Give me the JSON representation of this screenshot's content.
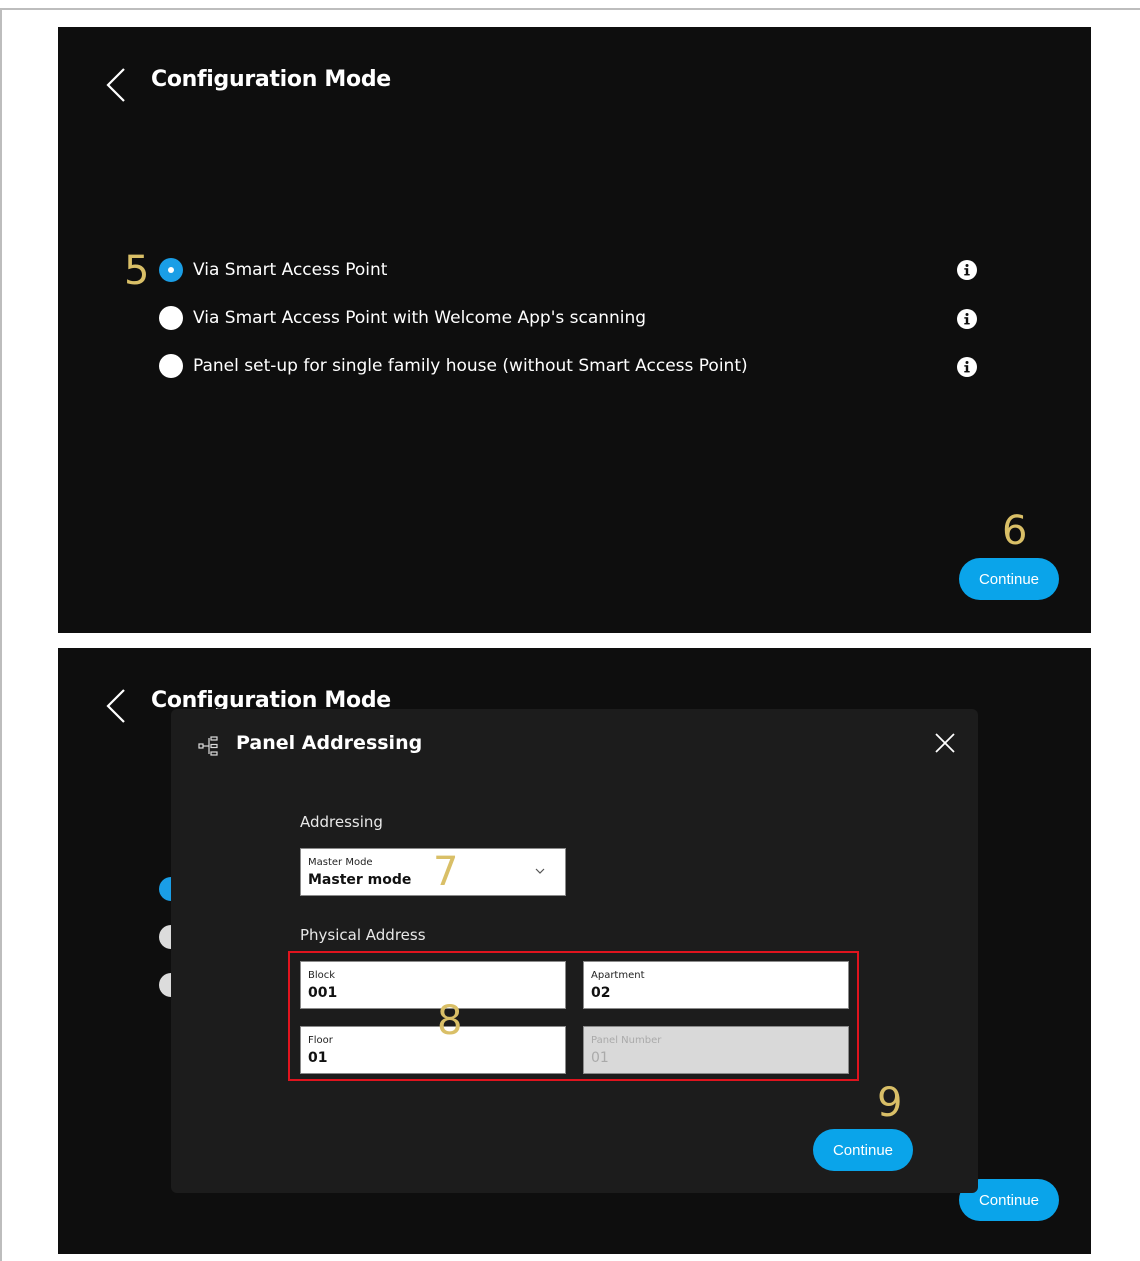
{
  "screen1": {
    "title": "Configuration Mode",
    "options": [
      {
        "label": "Via Smart Access Point",
        "selected": true
      },
      {
        "label": "Via Smart Access Point with Welcome App's scanning",
        "selected": false
      },
      {
        "label": "Panel set-up for single family house (without Smart Access Point)",
        "selected": false
      }
    ],
    "continue_label": "Continue"
  },
  "screen2": {
    "title": "Configuration Mode",
    "continue_label": "Continue",
    "dialog": {
      "title": "Panel Addressing",
      "addressing_label": "Addressing",
      "mode_field": {
        "label": "Master Mode",
        "value": "Master mode"
      },
      "physical_address_label": "Physical Address",
      "block": {
        "label": "Block",
        "value": "001"
      },
      "apartment": {
        "label": "Apartment",
        "value": "02"
      },
      "floor": {
        "label": "Floor",
        "value": "01"
      },
      "panel_number": {
        "label": "Panel Number",
        "value": "01",
        "disabled": true
      },
      "continue_label": "Continue"
    }
  },
  "callouts": {
    "c5": "5",
    "c6": "6",
    "c7": "7",
    "c8": "8",
    "c9": "9"
  },
  "colors": {
    "accent": "#0aa4ea",
    "callout": "#d9bf67",
    "highlight": "#e0141e",
    "background": "#0e0e0e"
  },
  "icons": [
    "back-chevron-icon",
    "info-icon",
    "panel-addressing-icon",
    "close-icon",
    "chevron-down-icon"
  ]
}
